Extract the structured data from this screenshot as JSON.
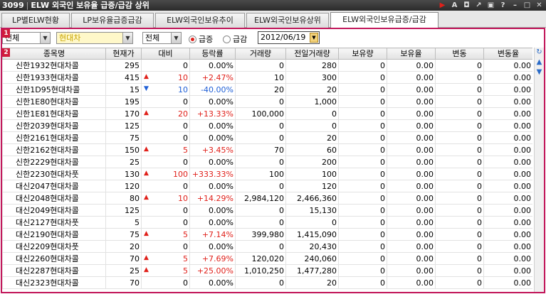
{
  "window": {
    "screen_no": "3099",
    "title": "ELW 외국인 보유율 급증/급감 상위"
  },
  "tabs": [
    {
      "label": "LP별ELW현황"
    },
    {
      "label": "LP보유율급증급감"
    },
    {
      "label": "ELW외국인보유추이"
    },
    {
      "label": "ELW외국인보유상위"
    },
    {
      "label": "ELW외국인보유급증/급감"
    }
  ],
  "markers": {
    "filter": "1",
    "grid": "2"
  },
  "filters": {
    "market": "전체",
    "underlying": "현대차",
    "type": "전체",
    "radio_increase": "급증",
    "radio_decrease": "급감",
    "radio_selected": "급증",
    "date": "2012/06/19"
  },
  "columns": [
    "종목명",
    "현재가",
    "대비",
    "등락률",
    "거래량",
    "전일거래량",
    "보유량",
    "보유율",
    "변동",
    "변동율"
  ],
  "rows": [
    {
      "name": "신한1932현대차콜",
      "price": "295",
      "dir": "",
      "change": "0",
      "rate": "0.00%",
      "vol": "0",
      "prev_vol": "280",
      "hold": "0",
      "hold_rate": "0.00",
      "diff": "0",
      "diff_rate": "0.00"
    },
    {
      "name": "신한1933현대차콜",
      "price": "415",
      "dir": "up",
      "change": "10",
      "rate": "+2.47%",
      "vol": "10",
      "prev_vol": "300",
      "hold": "0",
      "hold_rate": "0.00",
      "diff": "0",
      "diff_rate": "0.00"
    },
    {
      "name": "신한1D95현대차콜",
      "price": "15",
      "dir": "down",
      "change": "10",
      "rate": "-40.00%",
      "vol": "20",
      "prev_vol": "20",
      "hold": "0",
      "hold_rate": "0.00",
      "diff": "0",
      "diff_rate": "0.00"
    },
    {
      "name": "신한1E80현대차콜",
      "price": "195",
      "dir": "",
      "change": "0",
      "rate": "0.00%",
      "vol": "0",
      "prev_vol": "1,000",
      "hold": "0",
      "hold_rate": "0.00",
      "diff": "0",
      "diff_rate": "0.00"
    },
    {
      "name": "신한1E81현대차콜",
      "price": "170",
      "dir": "up",
      "change": "20",
      "rate": "+13.33%",
      "vol": "100,000",
      "prev_vol": "0",
      "hold": "0",
      "hold_rate": "0.00",
      "diff": "0",
      "diff_rate": "0.00"
    },
    {
      "name": "신한2039현대차콜",
      "price": "125",
      "dir": "",
      "change": "0",
      "rate": "0.00%",
      "vol": "0",
      "prev_vol": "0",
      "hold": "0",
      "hold_rate": "0.00",
      "diff": "0",
      "diff_rate": "0.00"
    },
    {
      "name": "신한2161현대차콜",
      "price": "75",
      "dir": "",
      "change": "0",
      "rate": "0.00%",
      "vol": "0",
      "prev_vol": "20",
      "hold": "0",
      "hold_rate": "0.00",
      "diff": "0",
      "diff_rate": "0.00"
    },
    {
      "name": "신한2162현대차콜",
      "price": "150",
      "dir": "up",
      "change": "5",
      "rate": "+3.45%",
      "vol": "70",
      "prev_vol": "60",
      "hold": "0",
      "hold_rate": "0.00",
      "diff": "0",
      "diff_rate": "0.00"
    },
    {
      "name": "신한2229현대차콜",
      "price": "25",
      "dir": "",
      "change": "0",
      "rate": "0.00%",
      "vol": "0",
      "prev_vol": "200",
      "hold": "0",
      "hold_rate": "0.00",
      "diff": "0",
      "diff_rate": "0.00"
    },
    {
      "name": "신한2230현대차풋",
      "price": "130",
      "dir": "up",
      "change": "100",
      "rate": "+333.33%",
      "vol": "100",
      "prev_vol": "100",
      "hold": "0",
      "hold_rate": "0.00",
      "diff": "0",
      "diff_rate": "0.00"
    },
    {
      "name": "대신2047현대차콜",
      "price": "120",
      "dir": "",
      "change": "0",
      "rate": "0.00%",
      "vol": "0",
      "prev_vol": "120",
      "hold": "0",
      "hold_rate": "0.00",
      "diff": "0",
      "diff_rate": "0.00"
    },
    {
      "name": "대신2048현대차콜",
      "price": "80",
      "dir": "up",
      "change": "10",
      "rate": "+14.29%",
      "vol": "2,984,120",
      "prev_vol": "2,466,360",
      "hold": "0",
      "hold_rate": "0.00",
      "diff": "0",
      "diff_rate": "0.00"
    },
    {
      "name": "대신2049현대차콜",
      "price": "125",
      "dir": "",
      "change": "0",
      "rate": "0.00%",
      "vol": "0",
      "prev_vol": "15,130",
      "hold": "0",
      "hold_rate": "0.00",
      "diff": "0",
      "diff_rate": "0.00"
    },
    {
      "name": "대신2127현대차풋",
      "price": "5",
      "dir": "",
      "change": "0",
      "rate": "0.00%",
      "vol": "0",
      "prev_vol": "0",
      "hold": "0",
      "hold_rate": "0.00",
      "diff": "0",
      "diff_rate": "0.00"
    },
    {
      "name": "대신2190현대차콜",
      "price": "75",
      "dir": "up",
      "change": "5",
      "rate": "+7.14%",
      "vol": "399,980",
      "prev_vol": "1,415,090",
      "hold": "0",
      "hold_rate": "0.00",
      "diff": "0",
      "diff_rate": "0.00"
    },
    {
      "name": "대신2209현대차풋",
      "price": "20",
      "dir": "",
      "change": "0",
      "rate": "0.00%",
      "vol": "0",
      "prev_vol": "20,430",
      "hold": "0",
      "hold_rate": "0.00",
      "diff": "0",
      "diff_rate": "0.00"
    },
    {
      "name": "대신2260현대차콜",
      "price": "70",
      "dir": "up",
      "change": "5",
      "rate": "+7.69%",
      "vol": "120,020",
      "prev_vol": "240,060",
      "hold": "0",
      "hold_rate": "0.00",
      "diff": "0",
      "diff_rate": "0.00"
    },
    {
      "name": "대신2287현대차콜",
      "price": "25",
      "dir": "up",
      "change": "5",
      "rate": "+25.00%",
      "vol": "1,010,250",
      "prev_vol": "1,477,280",
      "hold": "0",
      "hold_rate": "0.00",
      "diff": "0",
      "diff_rate": "0.00"
    },
    {
      "name": "대신2323현대차콜",
      "price": "70",
      "dir": "",
      "change": "0",
      "rate": "0.00%",
      "vol": "0",
      "prev_vol": "20",
      "hold": "0",
      "hold_rate": "0.00",
      "diff": "0",
      "diff_rate": "0.00"
    }
  ],
  "colors": {
    "up": "#e0201a",
    "down": "#1f5fd6",
    "frame": "#c2185b"
  }
}
